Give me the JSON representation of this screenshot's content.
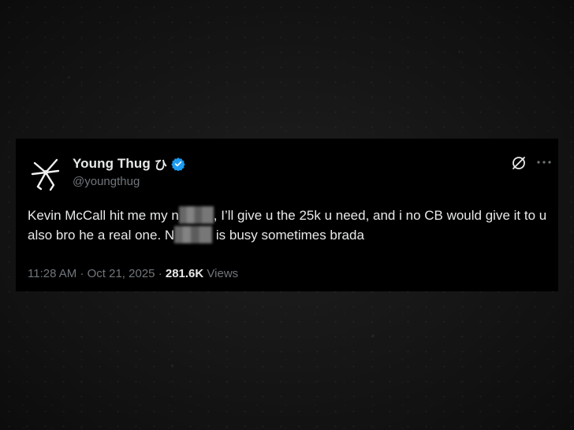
{
  "tweet": {
    "display_name": "Young Thug",
    "name_glyph": "ひ",
    "handle": "@youngthug",
    "text_parts": [
      "Kevin McCall hit me my n",
      ", I’ll give u the 25k u need, and i no CB would give it to u also bro he a real one. N",
      " is busy sometimes brada"
    ],
    "time": "11:28 AM",
    "separator": "·",
    "date": "Oct 21, 2025",
    "views_count": "281.6K",
    "views_label": "Views",
    "icons": {
      "avatar": "spider-logo-avatar",
      "verified": "verified-badge-icon",
      "grok": "grok-icon",
      "more": "more-options-icon"
    },
    "colors": {
      "card_bg": "#000000",
      "text": "#e7e9ea",
      "muted": "#71767b",
      "verified": "#1d9bf0"
    }
  }
}
